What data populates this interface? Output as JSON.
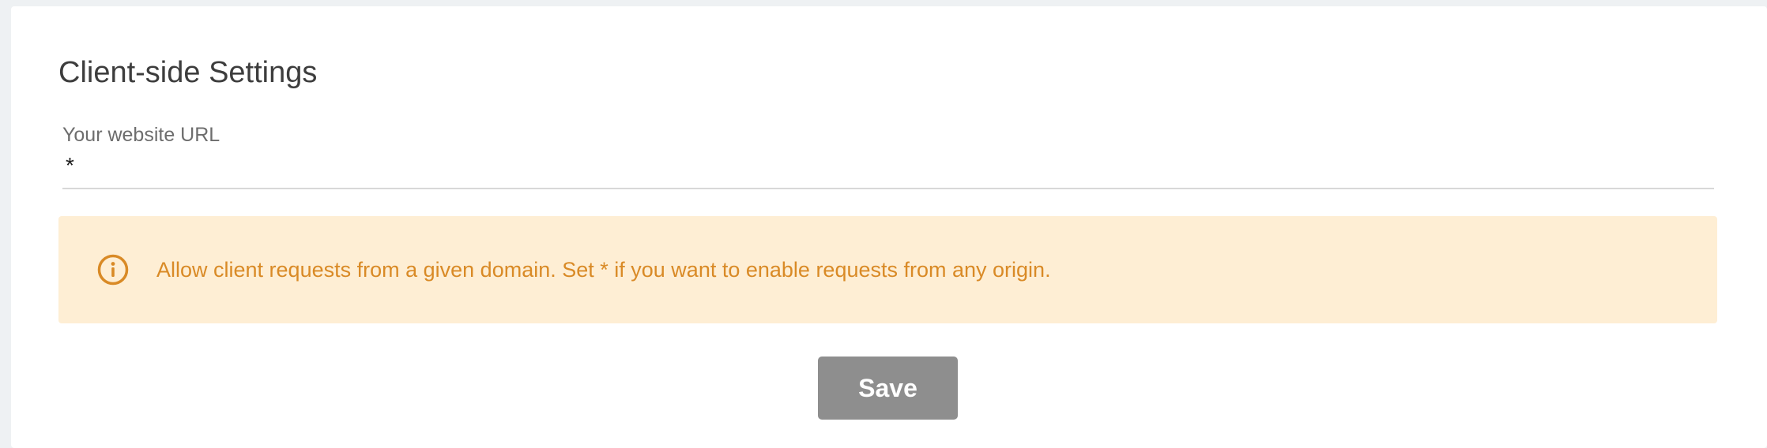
{
  "section": {
    "title": "Client-side Settings"
  },
  "website_url": {
    "label": "Your website URL",
    "value": "*"
  },
  "info_alert": {
    "icon": "info-circle-icon",
    "message": "Allow client requests from a given domain. Set * if you want to enable requests from any origin.",
    "color": "#d98a26",
    "background": "#feeed4"
  },
  "actions": {
    "save_label": "Save"
  }
}
